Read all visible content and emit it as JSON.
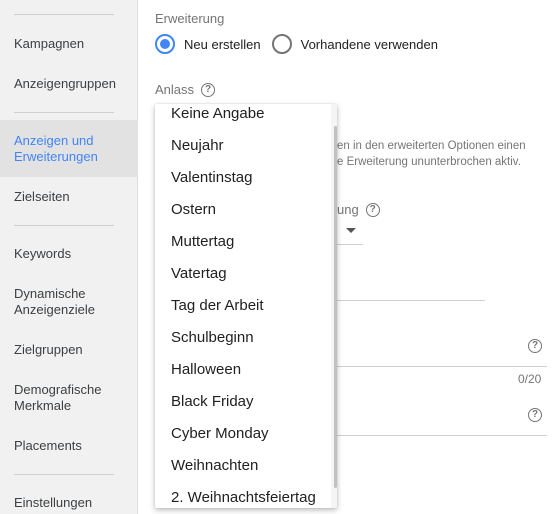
{
  "sidebar": {
    "items": [
      {
        "label": "Kampagnen"
      },
      {
        "label": "Anzeigengruppen"
      },
      {
        "label": "Anzeigen und Erweiterungen"
      },
      {
        "label": "Zielseiten"
      },
      {
        "label": "Keywords"
      },
      {
        "label": "Dynamische Anzeigenziele"
      },
      {
        "label": "Zielgruppen"
      },
      {
        "label": "Demografische Merkmale"
      },
      {
        "label": "Placements"
      },
      {
        "label": "Einstellungen"
      }
    ],
    "active_color": "#4285f4"
  },
  "main": {
    "extension_label": "Erweiterung",
    "radio_new": "Neu erstellen",
    "radio_existing": "Vorhandene verwenden",
    "occasion_label": "Anlass",
    "bg_text_line1": "en in den erweiterten Optionen einen",
    "bg_text_line2": "e Erweiterung ununterbrochen aktiv.",
    "bg_partial_label": "ung",
    "counter": "0/20"
  },
  "dropdown": {
    "options": [
      "Keine Angabe",
      "Neujahr",
      "Valentinstag",
      "Ostern",
      "Muttertag",
      "Vatertag",
      "Tag der Arbeit",
      "Schulbeginn",
      "Halloween",
      "Black Friday",
      "Cyber Monday",
      "Weihnachten",
      "2. Weihnachtsfeiertag"
    ]
  }
}
